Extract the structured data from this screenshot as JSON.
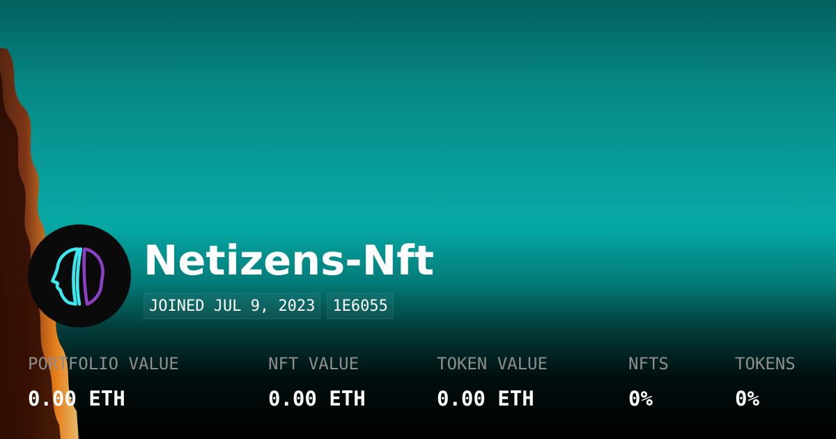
{
  "profile": {
    "name": "Netizens-Nft",
    "joined": "JOINED JUL 9, 2023",
    "address": "1E6055",
    "avatar_icon": "netizens-head-logo-icon"
  },
  "stats": [
    {
      "label": "PORTFOLIO VALUE",
      "value": "0.00 ETH"
    },
    {
      "label": "NFT VALUE",
      "value": "0.00 ETH"
    },
    {
      "label": "TOKEN VALUE",
      "value": "0.00 ETH"
    },
    {
      "label": "NFTS",
      "value": "0%"
    },
    {
      "label": "TOKENS",
      "value": "0%"
    }
  ],
  "colors": {
    "background_teal": "#09a4a1",
    "logo_cyan": "#3ee6ee",
    "logo_purple": "#8a3fc4",
    "label_gray": "#8e8e8e",
    "text_white": "#ffffff"
  }
}
